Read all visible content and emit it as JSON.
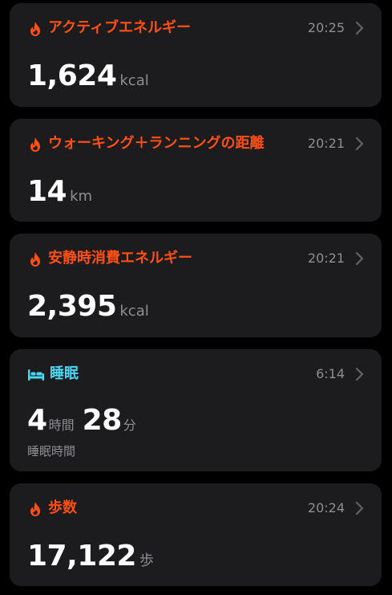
{
  "colors": {
    "accent_orange": "#ff4f12",
    "accent_cyan": "#48d7f5",
    "card_bg": "#1c1c1e",
    "secondary_text": "#8e8e93"
  },
  "cards": [
    {
      "icon": "flame-icon",
      "title": "アクティブエネルギー",
      "time": "20:25",
      "value": "1,624",
      "unit": "kcal"
    },
    {
      "icon": "flame-icon",
      "title": "ウォーキング＋ランニングの距離",
      "time": "20:21",
      "value": "14",
      "unit": "km"
    },
    {
      "icon": "flame-icon",
      "title": "安静時消費エネルギー",
      "time": "20:21",
      "value": "2,395",
      "unit": "kcal"
    },
    {
      "icon": "bed-icon",
      "title": "睡眠",
      "time": "6:14",
      "hours": "4",
      "hours_unit": "時間",
      "minutes": "28",
      "minutes_unit": "分",
      "caption": "睡眠時間"
    },
    {
      "icon": "flame-icon",
      "title": "歩数",
      "time": "20:24",
      "value": "17,122",
      "unit": "歩"
    }
  ]
}
